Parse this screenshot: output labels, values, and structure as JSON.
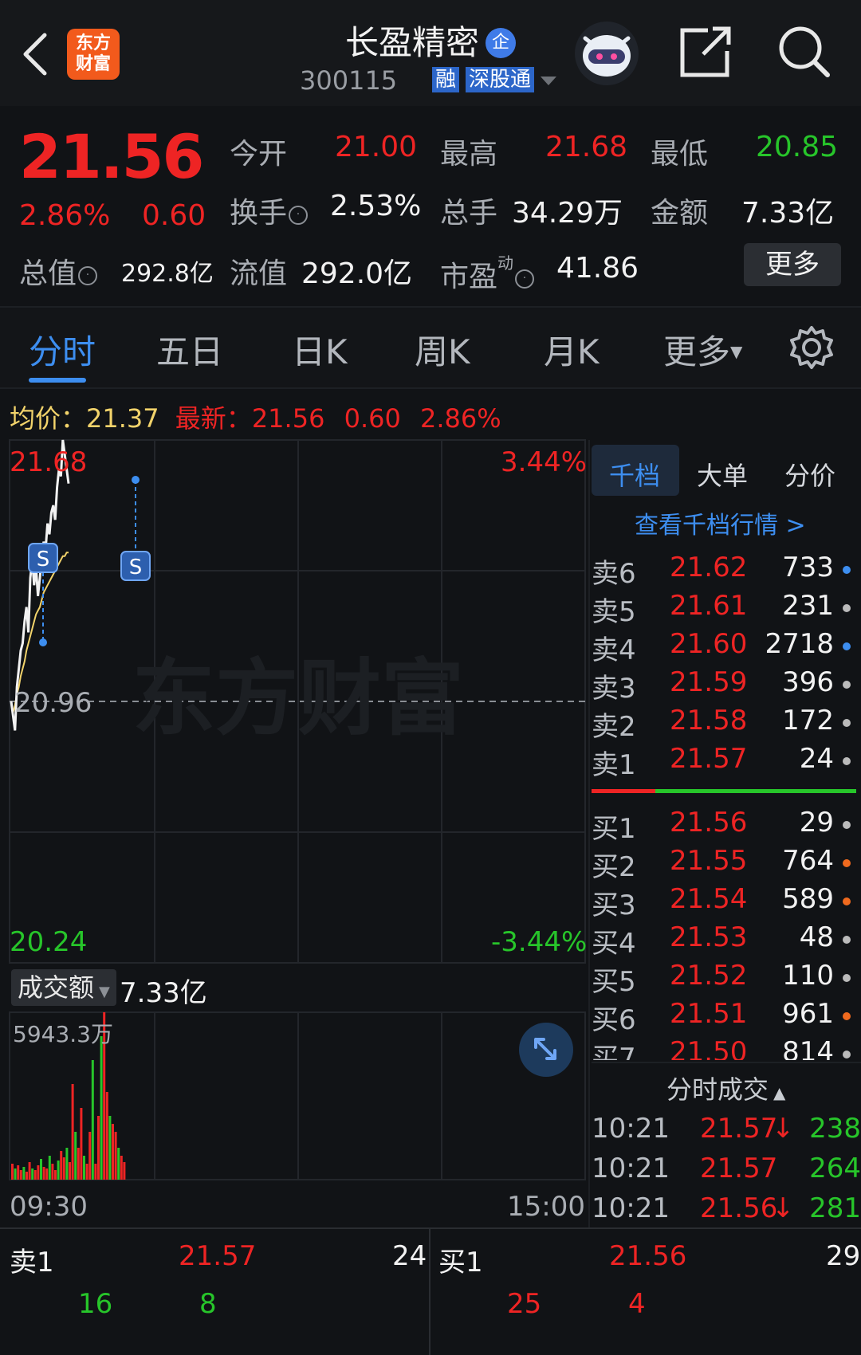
{
  "header": {
    "title": "长盈精密",
    "badge": "企",
    "code": "300115",
    "tags": [
      "融",
      "深股通"
    ]
  },
  "quote": {
    "price": "21.56",
    "change_pct": "2.86%",
    "change": "0.60",
    "open_label": "今开",
    "open": "21.00",
    "high_label": "最高",
    "high": "21.68",
    "low_label": "最低",
    "low": "20.85",
    "turnover_label": "换手",
    "turnover": "2.53%",
    "volume_label": "总手",
    "volume": "34.29万",
    "amount_label": "金额",
    "amount": "7.33亿",
    "total_cap_label": "总值",
    "total_cap": "292.8亿",
    "float_cap_label": "流值",
    "float_cap": "292.0亿",
    "pe_label": "市盈",
    "pe_super": "动",
    "pe": "41.86",
    "more_label": "更多"
  },
  "tabs": [
    "分时",
    "五日",
    "日K",
    "周K",
    "月K",
    "更多"
  ],
  "avg_row": {
    "avg_label": "均价：",
    "avg": "21.37",
    "latest_label": "最新：",
    "latest": "21.56",
    "change": "0.60",
    "change_pct": "2.86%"
  },
  "chart": {
    "y_max": "21.68",
    "y_mid": "20.96",
    "y_min": "20.24",
    "pct_max": "3.44%",
    "pct_min": "-3.44%",
    "watermark": "东方财富",
    "marker": "S",
    "volume_label": "成交额",
    "volume_total": "7.33亿",
    "volume_max": "5943.3万",
    "time_start": "09:30",
    "time_end": "15:00"
  },
  "chart_data": {
    "type": "line",
    "x_range": [
      "09:30",
      "15:00"
    ],
    "ylim": [
      20.24,
      21.68
    ],
    "y_reference": 20.96,
    "price_series": [
      20.96,
      20.92,
      20.88,
      21.0,
      21.05,
      21.1,
      21.12,
      21.18,
      21.22,
      21.15,
      21.3,
      21.35,
      21.28,
      21.33,
      21.25,
      21.3,
      21.36,
      21.4,
      21.38,
      21.45,
      21.42,
      21.48,
      21.5,
      21.46,
      21.55,
      21.6,
      21.58,
      21.68,
      21.64,
      21.6,
      21.56
    ],
    "avg_series": [
      20.96,
      20.93,
      20.95,
      20.98,
      21.0,
      21.03,
      21.05,
      21.07,
      21.1,
      21.12,
      21.14,
      21.16,
      21.18,
      21.2,
      21.21,
      21.22,
      21.24,
      21.26,
      21.27,
      21.28,
      21.29,
      21.3,
      21.31,
      21.32,
      21.33,
      21.34,
      21.35,
      21.36,
      21.36,
      21.37,
      21.37
    ]
  },
  "orderbook": {
    "tabs": [
      "千档",
      "大单",
      "分价"
    ],
    "link": "查看千档行情 >",
    "sells": [
      {
        "label": "卖6",
        "price": "21.62",
        "vol": "733",
        "dot": "#3d8ef0"
      },
      {
        "label": "卖5",
        "price": "21.61",
        "vol": "231",
        "dot": "#bbbbbb"
      },
      {
        "label": "卖4",
        "price": "21.60",
        "vol": "2718",
        "dot": "#3d8ef0"
      },
      {
        "label": "卖3",
        "price": "21.59",
        "vol": "396",
        "dot": "#bbbbbb"
      },
      {
        "label": "卖2",
        "price": "21.58",
        "vol": "172",
        "dot": "#bbbbbb"
      },
      {
        "label": "卖1",
        "price": "21.57",
        "vol": "24",
        "dot": "#bbbbbb"
      }
    ],
    "buys": [
      {
        "label": "买1",
        "price": "21.56",
        "vol": "29",
        "dot": "#bbbbbb"
      },
      {
        "label": "买2",
        "price": "21.55",
        "vol": "764",
        "dot": "#f06a1e"
      },
      {
        "label": "买3",
        "price": "21.54",
        "vol": "589",
        "dot": "#f06a1e"
      },
      {
        "label": "买4",
        "price": "21.53",
        "vol": "48",
        "dot": "#bbbbbb"
      },
      {
        "label": "买5",
        "price": "21.52",
        "vol": "110",
        "dot": "#bbbbbb"
      },
      {
        "label": "买6",
        "price": "21.51",
        "vol": "961",
        "dot": "#f06a1e"
      },
      {
        "label": "买7",
        "price": "21.50",
        "vol": "814",
        "dot": "#bbbbbb"
      }
    ],
    "ticks_title": "分时成交",
    "ticks": [
      {
        "time": "10:21",
        "price": "21.57",
        "arrow": "↓",
        "vol": "238"
      },
      {
        "time": "10:21",
        "price": "21.57",
        "arrow": "",
        "vol": "264"
      },
      {
        "time": "10:21",
        "price": "21.56",
        "arrow": "↓",
        "vol": "281"
      }
    ]
  },
  "bottom": {
    "sell_label": "卖1",
    "sell_price": "21.57",
    "sell_vol": "24",
    "buy_label": "买1",
    "buy_price": "21.56",
    "buy_vol": "29",
    "sell_sub1": "16",
    "sell_sub2": "8",
    "buy_sub1": "25",
    "buy_sub2": "4"
  },
  "colors": {
    "up": "#ee2424",
    "down": "#27c52a",
    "accent": "#3d8ef0",
    "brand": "#f25a1c"
  }
}
